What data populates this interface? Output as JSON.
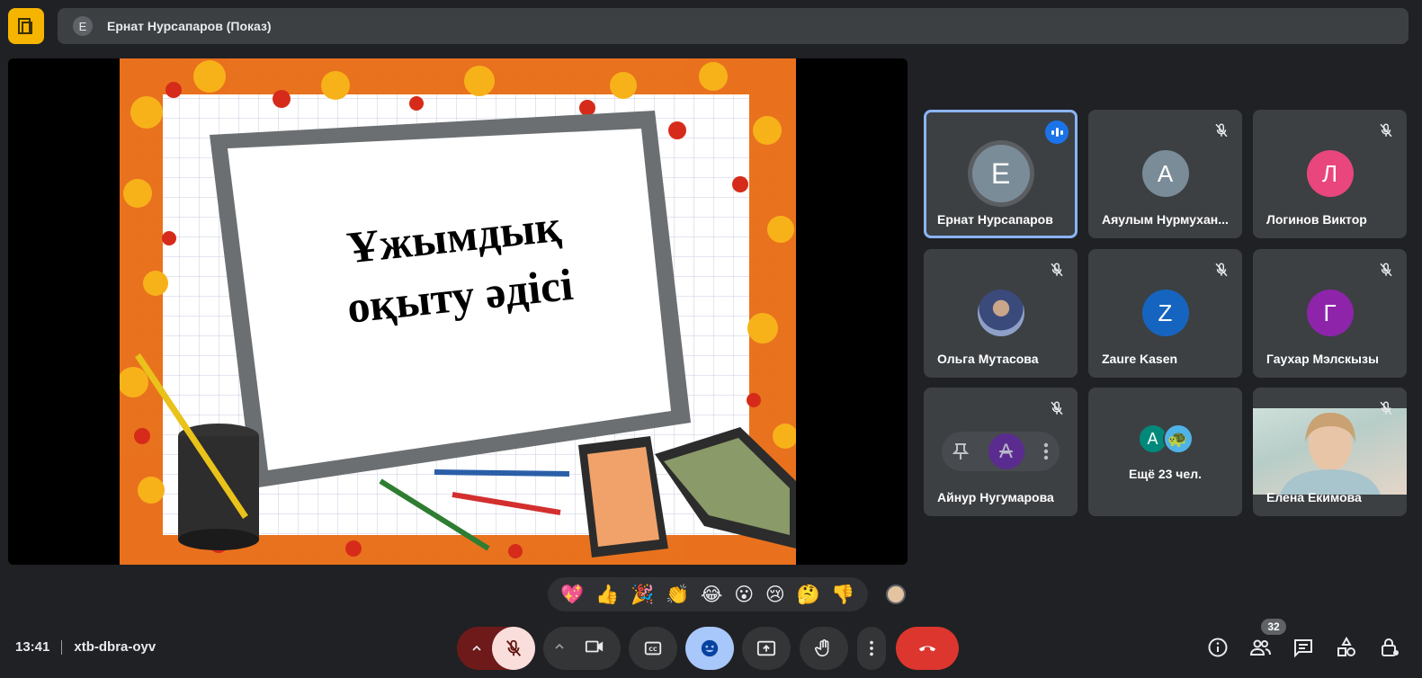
{
  "app": {
    "logo_icon": "presentation-logo-icon",
    "accent_color": "#f4b400"
  },
  "top_bar": {
    "avatar_letter": "E",
    "title": "Ернат Нурсапаров (Показ)"
  },
  "slide": {
    "line1": "Ұжымдық",
    "line2": "оқыту әдісі"
  },
  "participants": [
    {
      "name": "Ернат Нурсапаров",
      "initial": "E",
      "color": "#7a8c98",
      "speaking": true
    },
    {
      "name": "Аяулым Нурмухан...",
      "initial": "А",
      "color": "#7a8c98",
      "muted": true
    },
    {
      "name": "Логинов Виктор",
      "initial": "Л",
      "color": "#e8467c",
      "muted": true
    },
    {
      "name": "Ольга Мутасова",
      "initial": "",
      "color": "#6b7ea8",
      "muted": true,
      "photo": true
    },
    {
      "name": "Zaure Kasen",
      "initial": "Z",
      "color": "#1565c0",
      "muted": true
    },
    {
      "name": "Гаухар Мэлскызы",
      "initial": "Г",
      "color": "#8e24aa",
      "muted": true
    },
    {
      "name": "Айнур Нугумарова",
      "initial": "А",
      "color": "#5b2c8f",
      "muted": true
    },
    {
      "name": "Ещё 23 чел.",
      "initial": "А",
      "color": "#00897b"
    },
    {
      "name": "Елена Екимова",
      "muted": true,
      "video": true
    }
  ],
  "reactions": [
    "💖",
    "👍",
    "🎉",
    "👏",
    "😂",
    "😮",
    "😢",
    "🤔",
    "👎"
  ],
  "bottom": {
    "time": "13:41",
    "meeting_code": "xtb-dbra-oyv",
    "participants_count": "32"
  }
}
